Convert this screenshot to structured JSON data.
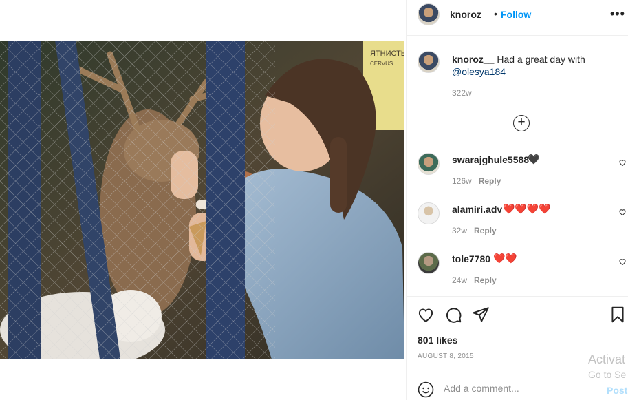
{
  "post": {
    "username": "knoroz__",
    "follow_label": "Follow",
    "separator": "•",
    "more_label": "•••",
    "photo_sign_text": "ЯТНИСТЫ",
    "photo_sign_sub": "CERVUS"
  },
  "caption": {
    "username": "knoroz__",
    "text": "Had a great day with",
    "mention": "@olesya184",
    "time": "322w"
  },
  "load_more_label": "+",
  "comments": [
    {
      "username": "swarajghule5588",
      "emoji": "🖤",
      "time": "126w",
      "reply_label": "Reply"
    },
    {
      "username": "alamiri.adv",
      "emoji": "❤️❤️❤️❤️",
      "time": "32w",
      "reply_label": "Reply"
    },
    {
      "username": "tole7780",
      "emoji": "❤️❤️",
      "time": "24w",
      "reply_label": "Reply"
    }
  ],
  "likes_text": "801 likes",
  "date_text": "AUGUST 8, 2015",
  "add_comment": {
    "placeholder": "Add a comment...",
    "post_label": "Post"
  },
  "watermark": {
    "line1": "Activat",
    "line2": "Go to Se"
  },
  "colors": {
    "accent": "#0095f6",
    "post_disabled": "#b2dffc",
    "muted": "#8e8e8e",
    "heart": "#ed4956"
  }
}
